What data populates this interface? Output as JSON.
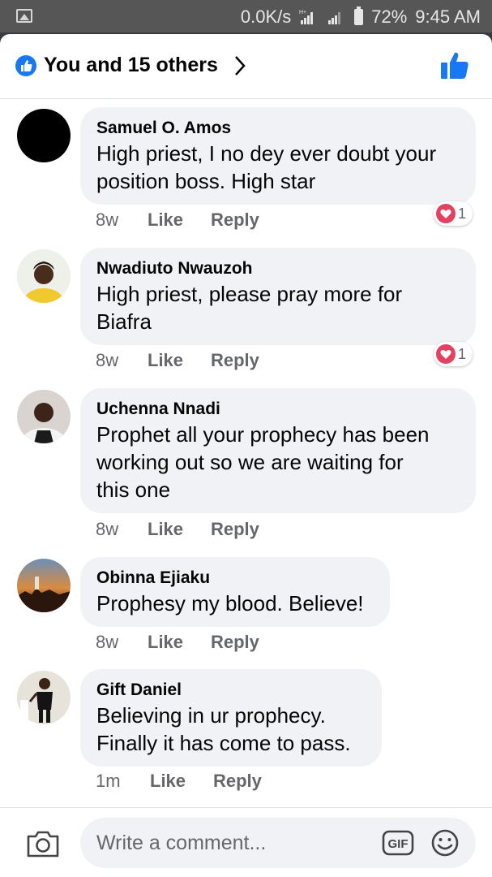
{
  "status_bar": {
    "net_speed": "0.0K/s",
    "network_type": "H+",
    "battery": "72%",
    "time": "9:45 AM",
    "icons": [
      "gallery-icon",
      "signal-icon",
      "battery-icon"
    ]
  },
  "header": {
    "title": "You and 15 others",
    "icons": [
      "like-badge-icon",
      "chevron-right-icon",
      "thumbs-up-icon"
    ],
    "accent": "#1877f2"
  },
  "comments": [
    {
      "name": "Samuel O. Amos",
      "text_lines": [
        "High priest, I no dey ever doubt your",
        "position boss. High star"
      ],
      "time": "8w",
      "like": "Like",
      "reply": "Reply",
      "reaction_count": "1"
    },
    {
      "name": "Nwadiuto Nwauzoh",
      "text_lines": [
        "High priest, please pray more for",
        "Biafra"
      ],
      "time": "8w",
      "like": "Like",
      "reply": "Reply",
      "reaction_count": "1"
    },
    {
      "name": "Uchenna Nnadi",
      "text_lines": [
        "Prophet all your prophecy has been",
        "working out so we are waiting for",
        "this one"
      ],
      "time": "8w",
      "like": "Like",
      "reply": "Reply"
    },
    {
      "name": "Obinna Ejiaku",
      "text_lines": [
        "Prophesy my blood. Believe!"
      ],
      "time": "8w",
      "like": "Like",
      "reply": "Reply"
    },
    {
      "name": "Gift Daniel",
      "text_lines": [
        "Believing in ur prophecy.",
        "Finally it has come to pass."
      ],
      "time": "1m",
      "like": "Like",
      "reply": "Reply"
    }
  ],
  "composer": {
    "placeholder": "Write a comment...",
    "gif_label": "GIF",
    "icons": [
      "camera-icon",
      "gif-icon",
      "emoji-icon"
    ]
  },
  "colors": {
    "reaction_heart": "#e4405f",
    "bubble": "#f0f2f5",
    "meta_text": "#65676b"
  }
}
